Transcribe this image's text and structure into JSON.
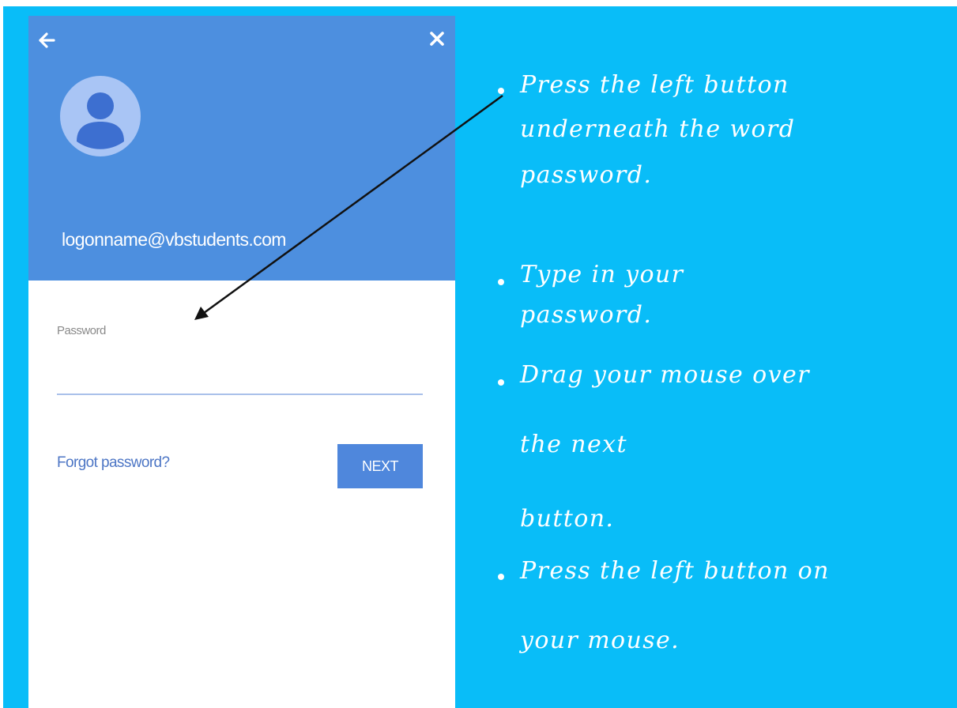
{
  "login": {
    "email": "logonname@vbstudents.com",
    "password_label": "Password",
    "password_value": "",
    "forgot_link": "Forgot password?",
    "next_button": "NEXT"
  },
  "instructions": [
    {
      "lines": [
        "Press the left button",
        "underneath the word",
        "password."
      ]
    },
    {
      "lines": [
        "Type in your",
        "password."
      ]
    },
    {
      "lines": [
        "Drag your mouse over",
        "the next",
        "button."
      ]
    },
    {
      "lines": [
        "Press the left button on",
        "your mouse."
      ]
    }
  ],
  "colors": {
    "slide_background": "#09bdf8",
    "card_header": "#4d8fdf",
    "button": "#4f87dc",
    "link": "#4d76c5"
  }
}
